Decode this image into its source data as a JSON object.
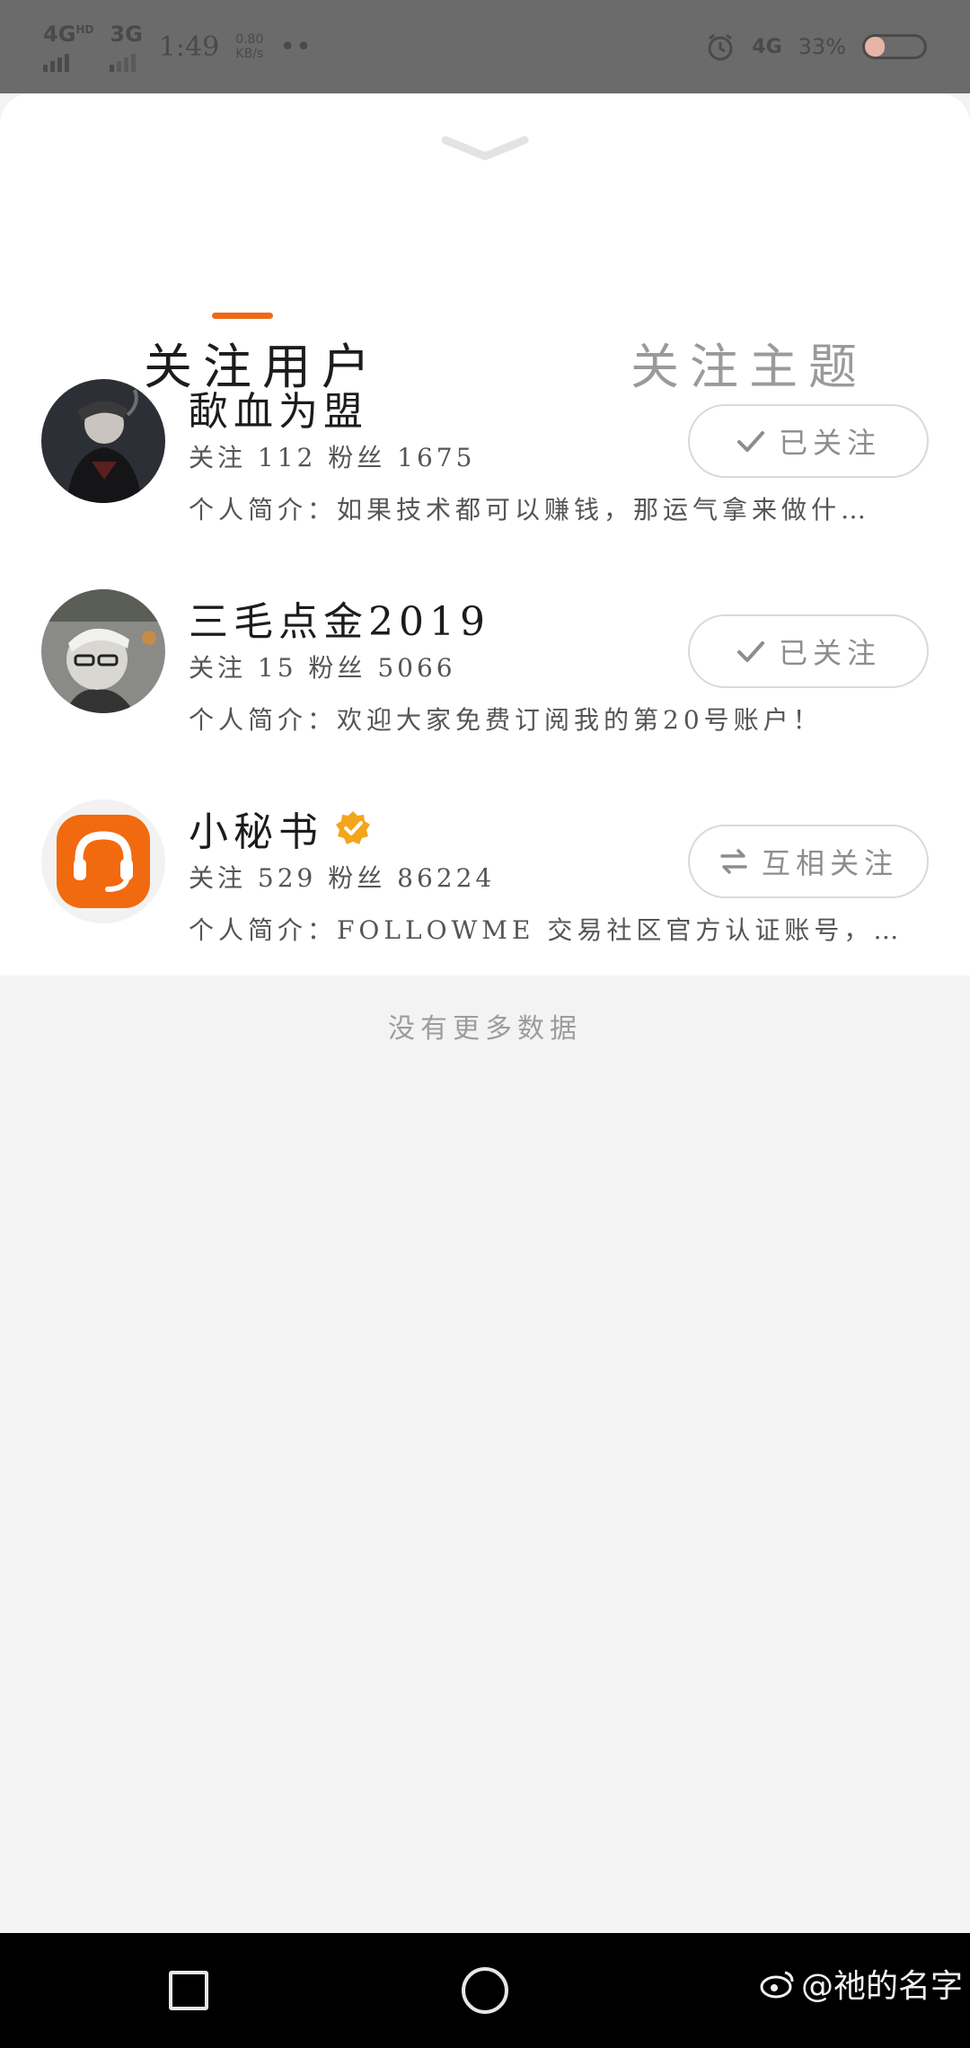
{
  "status_bar": {
    "network_1": "4G",
    "network_1_sup": "HD",
    "network_2": "3G",
    "time": "1:49",
    "speed_value": "0.80",
    "speed_unit": "KB/s",
    "dots": "••",
    "right_network": "4G",
    "battery_percent": "33%",
    "battery_level": 0.33
  },
  "sheet": {
    "tabs": [
      {
        "label": "关注用户",
        "active": true
      },
      {
        "label": "关注主题",
        "active": false
      }
    ],
    "accent_color": "#ee6a18"
  },
  "users": [
    {
      "name": "歃血为盟",
      "stats": "关注 112 粉丝 1675",
      "bio": "个人简介：如果技术都可以赚钱，那运气拿来做什…",
      "button_label": "已关注",
      "button_icon": "check-icon",
      "verified": false
    },
    {
      "name": "三毛点金2019",
      "stats": "关注 15 粉丝 5066",
      "bio": "个人简介：欢迎大家免费订阅我的第20号账户！",
      "button_label": "已关注",
      "button_icon": "check-icon",
      "verified": false
    },
    {
      "name": "小秘书",
      "stats": "关注 529 粉丝 86224",
      "bio": "个人简介：FOLLOWME 交易社区官方认证账号，对 F…",
      "button_label": "互相关注",
      "button_icon": "mutual-arrows-icon",
      "verified": true
    }
  ],
  "footer_note": "没有更多数据",
  "nav_bar": {
    "watermark": "@祂的名字"
  }
}
